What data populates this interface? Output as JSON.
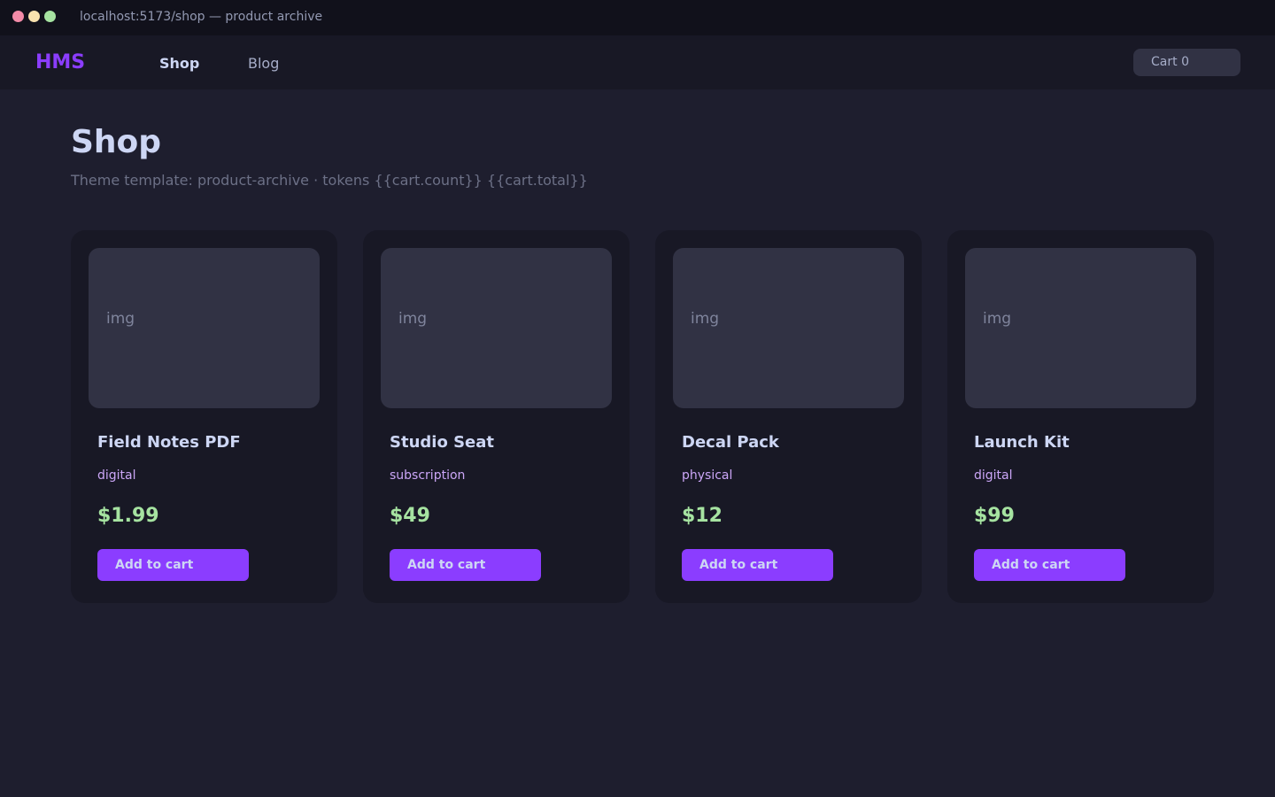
{
  "window": {
    "url_title": "localhost:5173/shop — product archive",
    "controls": [
      "close",
      "minimize",
      "maximize"
    ]
  },
  "nav": {
    "brand": "HMS",
    "links": [
      {
        "label": "Shop",
        "active": true
      },
      {
        "label": "Blog",
        "active": false
      }
    ],
    "cart_label": "Cart",
    "cart_count": "0"
  },
  "page": {
    "title": "Shop",
    "subtitle": "Theme template: product-archive · tokens {{cart.count}} {{cart.total}}"
  },
  "products": [
    {
      "image_placeholder": "img",
      "name": "Field Notes PDF",
      "type": "digital",
      "price": "$1.99",
      "button_label": "Add to cart"
    },
    {
      "image_placeholder": "img",
      "name": "Studio Seat",
      "type": "subscription",
      "price": "$49",
      "button_label": "Add to cart"
    },
    {
      "image_placeholder": "img",
      "name": "Decal Pack",
      "type": "physical",
      "price": "$12",
      "button_label": "Add to cart"
    },
    {
      "image_placeholder": "img",
      "name": "Launch Kit",
      "type": "digital",
      "price": "$99",
      "button_label": "Add to cart"
    }
  ],
  "colors": {
    "background": "#1e1e2e",
    "surface": "#181825",
    "accent": "#8b3dff",
    "price": "#a6e3a1",
    "tag": "#cba6f7"
  }
}
